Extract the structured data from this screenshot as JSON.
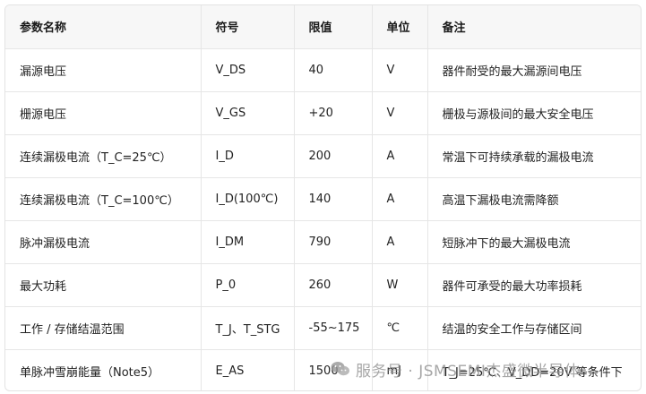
{
  "table": {
    "headers": [
      "参数名称",
      "符号",
      "限值",
      "单位",
      "备注"
    ],
    "rows": [
      [
        "漏源电压",
        "V_DS",
        "40",
        "V",
        "器件耐受的最大漏源间电压"
      ],
      [
        "栅源电压",
        "V_GS",
        "+20",
        "V",
        "栅极与源极间的最大安全电压"
      ],
      [
        "连续漏极电流（T_C=25℃）",
        "I_D",
        "200",
        "A",
        "常温下可持续承载的漏极电流"
      ],
      [
        "连续漏极电流（T_C=100℃）",
        "I_D(100℃)",
        "140",
        "A",
        "高温下漏极电流需降额"
      ],
      [
        "脉冲漏极电流",
        "I_DM",
        "790",
        "A",
        "短脉冲下的最大漏极电流"
      ],
      [
        "最大功耗",
        "P_0",
        "260",
        "W",
        "器件可承受的最大功率损耗"
      ],
      [
        "工作 / 存储结温范围",
        "T_J、T_STG",
        "-55~175",
        "℃",
        "结温的安全工作与存储区间"
      ],
      [
        "单脉冲雪崩能量（Note5）",
        "E_AS",
        "1500",
        "mJ",
        "T_J=25℃、V_DD=20V 等条件下"
      ]
    ]
  },
  "watermark": {
    "text": "服务号 · JSMSEMI杰盛微半导体",
    "icon": "wechat-icon"
  }
}
